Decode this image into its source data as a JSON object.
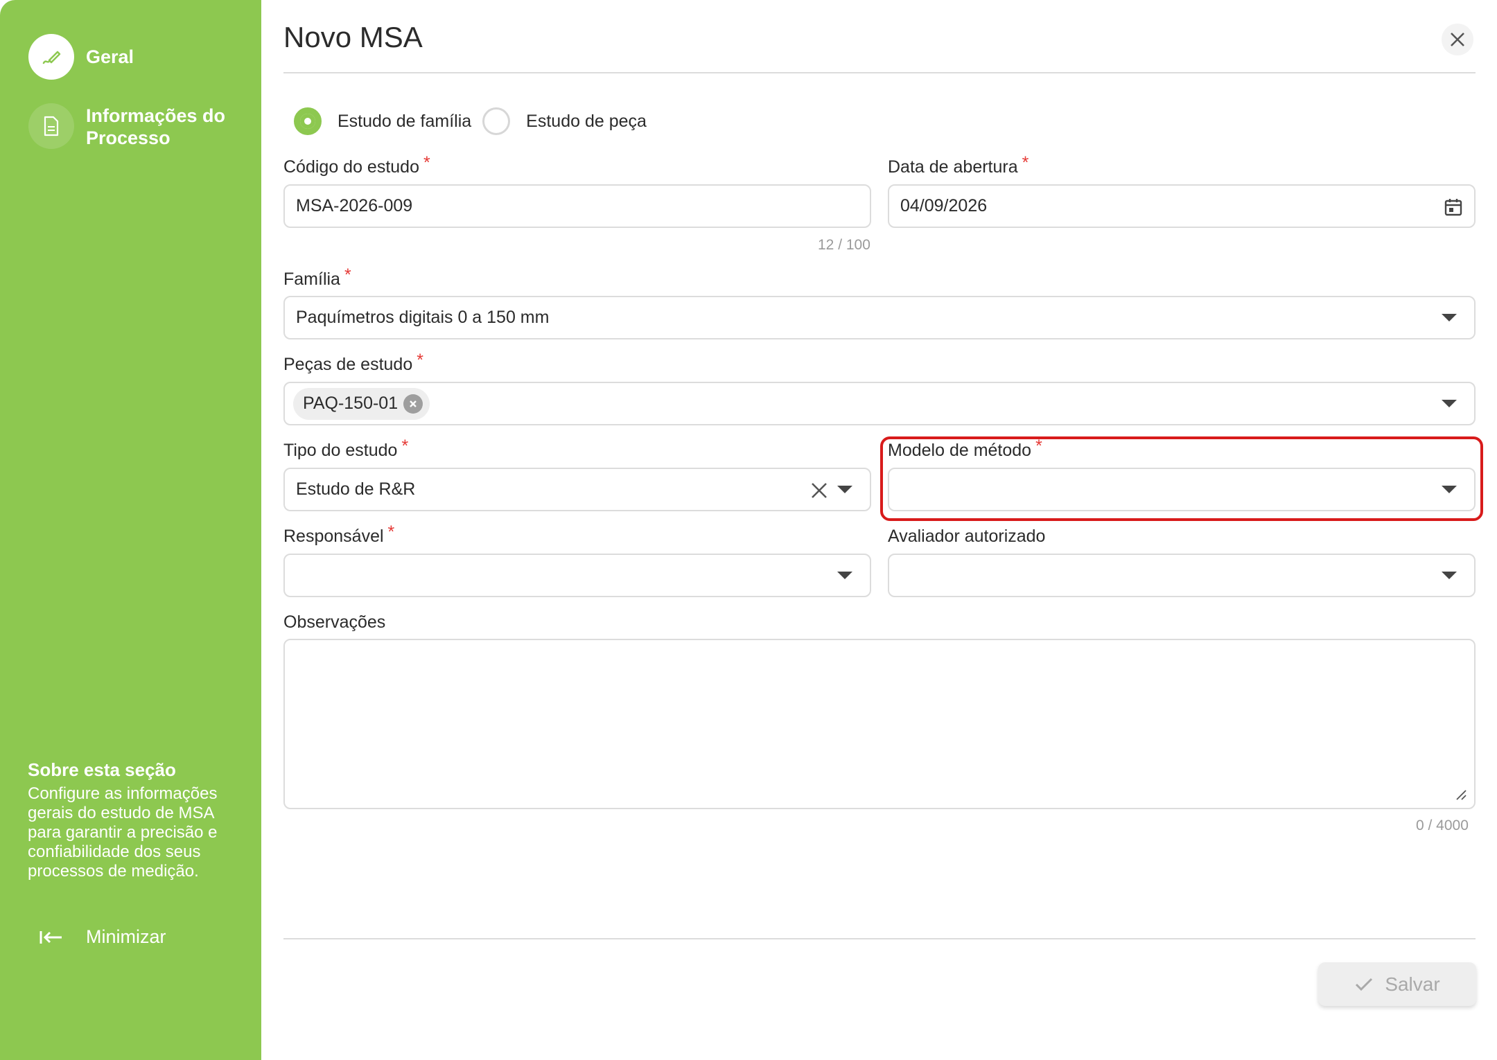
{
  "sidebar": {
    "items": [
      {
        "label": "Geral",
        "icon": "edit-icon",
        "active": true
      },
      {
        "label": "Informações do Processo",
        "icon": "document-icon",
        "active": false
      }
    ],
    "about_title": "Sobre esta seção",
    "about_text": "Configure as informações gerais do estudo de MSA para garantir a precisão e confiabilidade dos seus processos de medição.",
    "minimize_label": "Minimizar",
    "color": "#8dc850"
  },
  "dialog": {
    "title": "Novo MSA",
    "radio": {
      "options": [
        "Estudo de família",
        "Estudo de peça"
      ],
      "selected": "Estudo de família"
    },
    "fields": {
      "codigo": {
        "label": "Código do estudo",
        "required": "*",
        "value": "MSA-2026-009",
        "counter": "12 / 100"
      },
      "data": {
        "label": "Data de abertura",
        "required": "*",
        "value": "04/09/2026"
      },
      "familia": {
        "label": "Família",
        "required": "*",
        "value": "Paquímetros digitais 0 a 150 mm"
      },
      "pecas": {
        "label": "Peças de estudo",
        "required": "*",
        "chips": [
          "PAQ-150-01"
        ]
      },
      "tipo": {
        "label": "Tipo do estudo",
        "required": "*",
        "value": "Estudo de R&R"
      },
      "modelo": {
        "label": "Modelo de método",
        "required": "*",
        "value": ""
      },
      "responsavel": {
        "label": "Responsável",
        "required": "*",
        "value": ""
      },
      "avaliador": {
        "label": "Avaliador autorizado",
        "value": ""
      },
      "observacoes": {
        "label": "Observações",
        "value": "",
        "counter": "0 / 4000"
      }
    },
    "save_label": "Salvar",
    "highlight_color": "#d81b1b"
  }
}
